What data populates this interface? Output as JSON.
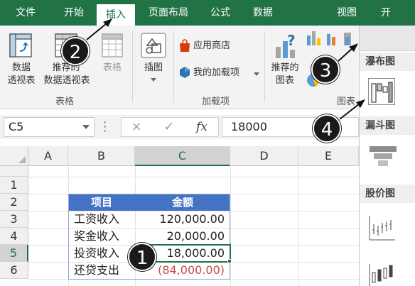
{
  "ribbon": {
    "tabs": [
      "文件",
      "开始",
      "插入",
      "页面布局",
      "公式",
      "数据",
      "视图",
      "开"
    ],
    "active_tab": "插入",
    "groups": {
      "tables": {
        "label": "表格",
        "pivot_line1": "数据",
        "pivot_line2": "透视表",
        "recommended_line1": "推荐的",
        "recommended_line2": "数据透视表",
        "table": "表格"
      },
      "illustrations": {
        "label": "插图"
      },
      "addins": {
        "label": "加载项",
        "store": "应用商店",
        "my_addins": "我的加载项"
      },
      "charts": {
        "label": "图表",
        "recommended_line1": "推荐的",
        "recommended_line2": "图表"
      }
    }
  },
  "formula_bar": {
    "name_box": "C5",
    "cancel": "×",
    "enter": "✓",
    "fx": "fx",
    "value": "18000"
  },
  "sheet": {
    "columns": [
      "A",
      "B",
      "C",
      "D",
      "E"
    ],
    "rows": [
      "1",
      "2",
      "3",
      "4",
      "5",
      "6"
    ],
    "table": {
      "headers": [
        "项目",
        "金额"
      ],
      "rows": [
        [
          "工资收入",
          "120,000.00"
        ],
        [
          "奖金收入",
          "20,000.00"
        ],
        [
          "投资收入",
          "18,000.00"
        ],
        [
          "还贷支出",
          "(84,000.00)"
        ]
      ]
    }
  },
  "chart_panel": {
    "sections": [
      "瀑布图",
      "漏斗图",
      "股价图"
    ]
  },
  "callouts": [
    "1",
    "2",
    "3",
    "4"
  ],
  "colors": {
    "ribbon_green": "#217346",
    "table_header": "#4472c4",
    "negative": "#c0504d"
  }
}
